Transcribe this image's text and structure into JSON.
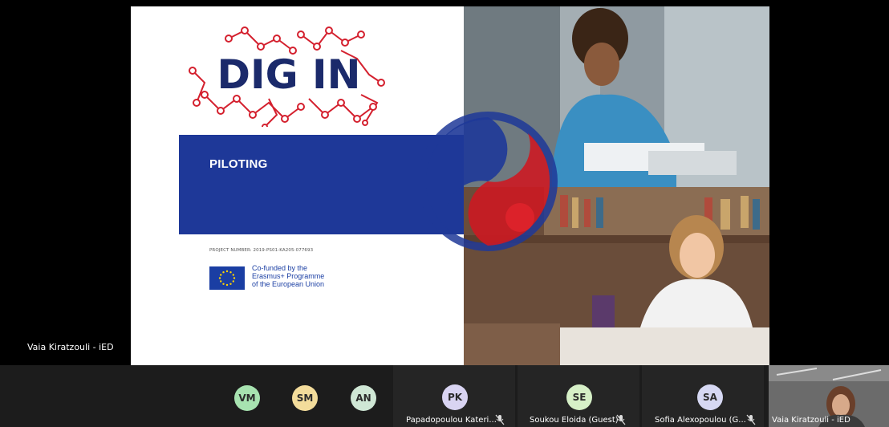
{
  "presenter": {
    "name": "Vaia Kiratzouli - iED"
  },
  "slide": {
    "logo_text": "DIG IN",
    "banner_title": "PILOTING",
    "project_number": "PROJECT NUMBER: 2019-PS01-KA205-077693",
    "eu_lines": [
      "Co-funded by the",
      "Erasmus+ Programme",
      "of the European Union"
    ]
  },
  "participants": [
    {
      "initials": "VM",
      "color": "#a7e3b0"
    },
    {
      "initials": "SM",
      "color": "#f3dc9b"
    },
    {
      "initials": "AN",
      "color": "#cfe7d5"
    },
    {
      "initials": "PK",
      "color": "#d9d4f2",
      "name": "Papadopoulou Kateri..."
    },
    {
      "initials": "SE",
      "color": "#d6f0c7",
      "name": "Soukou Eloida (Guest)"
    },
    {
      "initials": "SA",
      "color": "#d6d8f3",
      "name": "Sofia Alexopoulou (G..."
    }
  ],
  "self_view": {
    "name": "Vaia Kiratzouli - iED"
  },
  "colors": {
    "banner": "#1e3898",
    "logo_red": "#d4202e",
    "logo_navy": "#1b2a6b"
  }
}
